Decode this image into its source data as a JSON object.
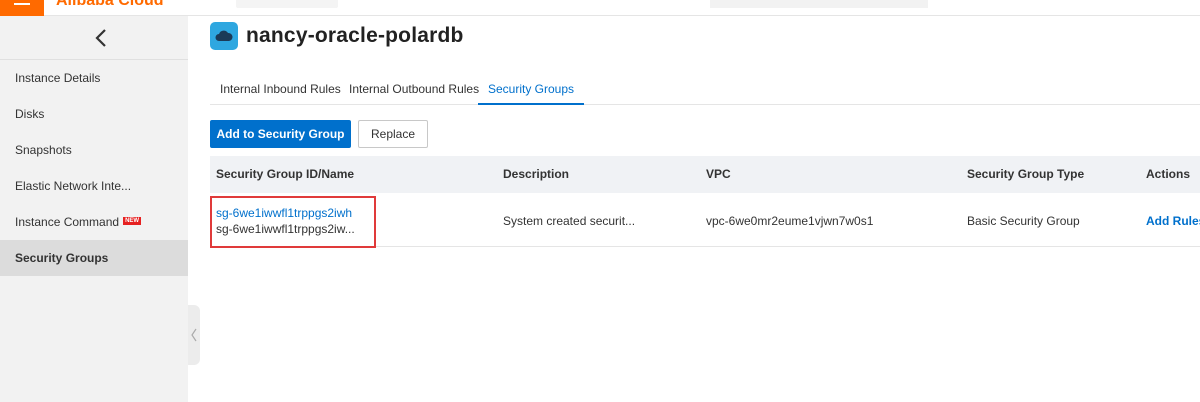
{
  "header": {
    "logo_text": "Alibaba Cloud"
  },
  "sidebar": {
    "items": [
      {
        "label": "Instance Details"
      },
      {
        "label": "Disks"
      },
      {
        "label": "Snapshots"
      },
      {
        "label": "Elastic Network Inte..."
      },
      {
        "label": "Instance Command",
        "badge": "NEW"
      },
      {
        "label": "Security Groups",
        "active": true
      }
    ]
  },
  "main": {
    "title": "nancy-oracle-polardb",
    "tabs": [
      {
        "label": "Internal Inbound Rules"
      },
      {
        "label": "Internal Outbound Rules"
      },
      {
        "label": "Security Groups",
        "active": true
      }
    ],
    "buttons": {
      "add": "Add to Security Group",
      "replace": "Replace"
    },
    "table": {
      "columns": [
        "Security Group ID/Name",
        "Description",
        "VPC",
        "Security Group Type",
        "Actions"
      ],
      "rows": [
        {
          "id": "sg-6we1iwwfl1trppgs2iwh",
          "name": "sg-6we1iwwfl1trppgs2iw...",
          "description": "System created securit...",
          "vpc": "vpc-6we0mr2eume1vjwn7w0s1",
          "type": "Basic Security Group",
          "action": "Add Rules"
        }
      ]
    }
  },
  "colors": {
    "accent": "#0070cc",
    "brand": "#ff6a00",
    "highlight": "#e03a3a"
  }
}
